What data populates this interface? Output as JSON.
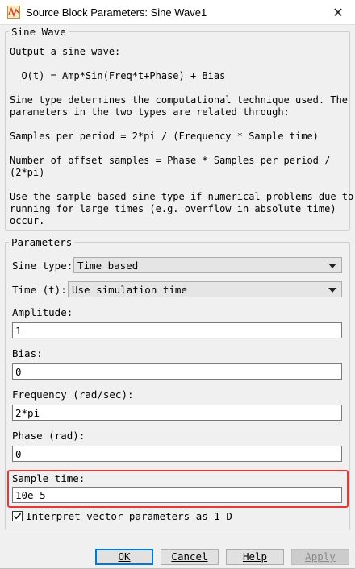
{
  "window": {
    "title": "Source Block Parameters: Sine Wave1",
    "close_symbol": "✕",
    "icon": "simulink-icon"
  },
  "description": {
    "group_title": "Sine Wave",
    "lines": [
      "Output a sine wave:",
      "",
      "  O(t) = Amp*Sin(Freq*t+Phase) + Bias",
      "",
      "Sine type determines the computational technique used. The",
      "parameters in the two types are related through:",
      "",
      "Samples per period = 2*pi / (Frequency * Sample time)",
      "",
      "Number of offset samples = Phase * Samples per period /",
      "(2*pi)",
      "",
      "Use the sample-based sine type if numerical problems due to",
      "running for large times (e.g. overflow in absolute time)",
      "occur."
    ]
  },
  "parameters": {
    "group_title": "Parameters",
    "sine_type": {
      "label": "Sine type:",
      "value": "Time based"
    },
    "time": {
      "label": "Time (t):",
      "value": "Use simulation time"
    },
    "amplitude": {
      "label": "Amplitude:",
      "value": "1"
    },
    "bias": {
      "label": "Bias:",
      "value": "0"
    },
    "frequency": {
      "label": "Frequency (rad/sec):",
      "value": "2*pi"
    },
    "phase": {
      "label": "Phase (rad):",
      "value": "0"
    },
    "sample_time": {
      "label": "Sample time:",
      "value": "10e-5"
    },
    "interpret_vector": {
      "label": "Interpret vector parameters as 1-D",
      "checked": true
    }
  },
  "buttons": {
    "ok": "OK",
    "cancel": "Cancel",
    "help": "Help",
    "apply": "Apply"
  },
  "colors": {
    "highlight": "#e53935",
    "default_button_border": "#0078d7"
  }
}
